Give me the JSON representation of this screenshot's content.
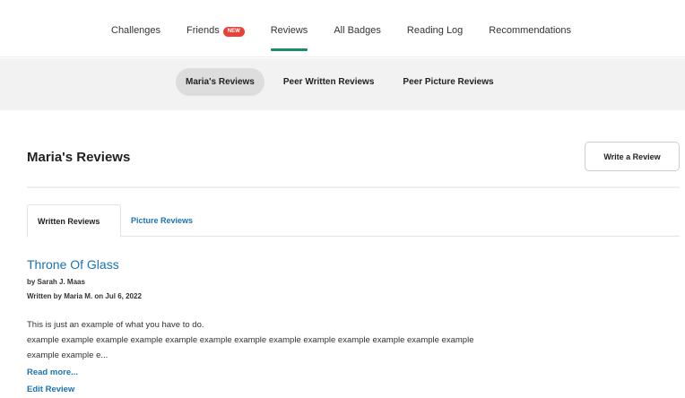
{
  "top_nav": {
    "items": [
      {
        "label": "Challenges"
      },
      {
        "label": "Friends",
        "badge": "NEW"
      },
      {
        "label": "Reviews",
        "active": true
      },
      {
        "label": "All Badges"
      },
      {
        "label": "Reading Log"
      },
      {
        "label": "Recommendations"
      }
    ],
    "active_color": "#1a8c6a",
    "badge_color": "#e8413a"
  },
  "sub_nav": {
    "items": [
      {
        "label": "Maria's Reviews",
        "active": true
      },
      {
        "label": "Peer Written Reviews"
      },
      {
        "label": "Peer Picture Reviews"
      }
    ]
  },
  "page": {
    "title": "Maria's Reviews",
    "write_button": "Write a Review"
  },
  "tabs": {
    "written": "Written Reviews",
    "picture": "Picture Reviews",
    "active": "written"
  },
  "review": {
    "title": "Throne Of Glass",
    "author": "by Sarah J. Maas",
    "written_by": "Written by Maria M. on Jul 6, 2022",
    "lines": [
      "This is just an example of what you have to do.",
      "example example example example example example example example example example example example example",
      "example example e..."
    ],
    "read_more": "Read more...",
    "edit": "Edit Review"
  },
  "link_color": "#1a73b5"
}
